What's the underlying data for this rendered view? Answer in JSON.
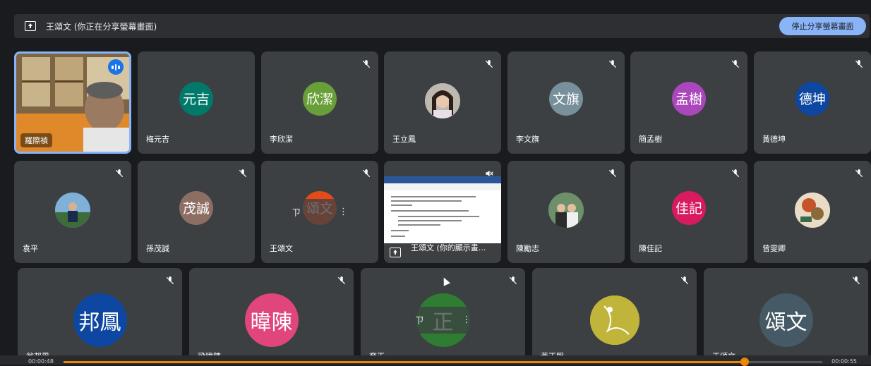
{
  "share_bar": {
    "text": "王頌文 (你正在分享螢幕畫面)",
    "stop_label": "停止分享螢幕畫面",
    "icon": "present-screen-icon"
  },
  "self_tile": {
    "name": "羅際禎",
    "speaking_icon": "speaking-indicator-icon"
  },
  "tiles": [
    {
      "name": "梅元吉",
      "avatar": "元吉",
      "color": "#00796b",
      "muted": false
    },
    {
      "name": "李欣潔",
      "avatar": "欣潔",
      "color": "#689f38",
      "muted": true
    },
    {
      "name": "王立鳳",
      "avatar": "",
      "color": "#8a8a8a",
      "muted": true
    },
    {
      "name": "李文旗",
      "avatar": "文旗",
      "color": "#78909c",
      "muted": true
    },
    {
      "name": "簡孟樹",
      "avatar": "孟樹",
      "color": "#ab47bc",
      "muted": true
    },
    {
      "name": "黃德坤",
      "avatar": "德坤",
      "color": "#0d47a1",
      "muted": true
    },
    {
      "name": "袁平",
      "avatar": "",
      "color": "#2a5a7a",
      "muted": true
    },
    {
      "name": "孫茂誠",
      "avatar": "茂誠",
      "color": "#8d6e63",
      "muted": true
    },
    {
      "name": "王頌文",
      "avatar": "頌文",
      "color": "#e64a19",
      "muted": true
    },
    {
      "name": "陳勵志",
      "avatar": "",
      "color": "#5d7a5a",
      "muted": true
    },
    {
      "name": "陳佳記",
      "avatar": "佳記",
      "color": "#d81b60",
      "muted": true
    },
    {
      "name": "曾雯卿",
      "avatar": "",
      "color": "#c9a27a",
      "muted": true
    },
    {
      "name": "翁邦鳳",
      "avatar": "邦鳳",
      "color": "#0d47a1",
      "muted": true
    },
    {
      "name": "梁暐陳",
      "avatar": "暐陳",
      "color": "#e0457b",
      "muted": true
    },
    {
      "name": "育正",
      "avatar": "正",
      "color": "#2e7d32",
      "muted": true
    },
    {
      "name": "黃正熙",
      "avatar": "",
      "color": "#c0b53a",
      "muted": true
    },
    {
      "name": "王頌文",
      "avatar": "頌文",
      "color": "#455a64",
      "muted": true
    }
  ],
  "screen_tile": {
    "label": "王頌文 (你的顯示畫...",
    "icon": "present-screen-icon",
    "sound_icon": "volume-off-icon"
  },
  "pin_pill": {
    "pin_icon": "pin-icon",
    "more_icon": "more-vert-icon",
    "pin_glyph": "ㄗ",
    "more_glyph": "⋮"
  },
  "playback": {
    "time_left": "00:00:48",
    "time_right": "00:00:55",
    "progress": 0.85
  }
}
